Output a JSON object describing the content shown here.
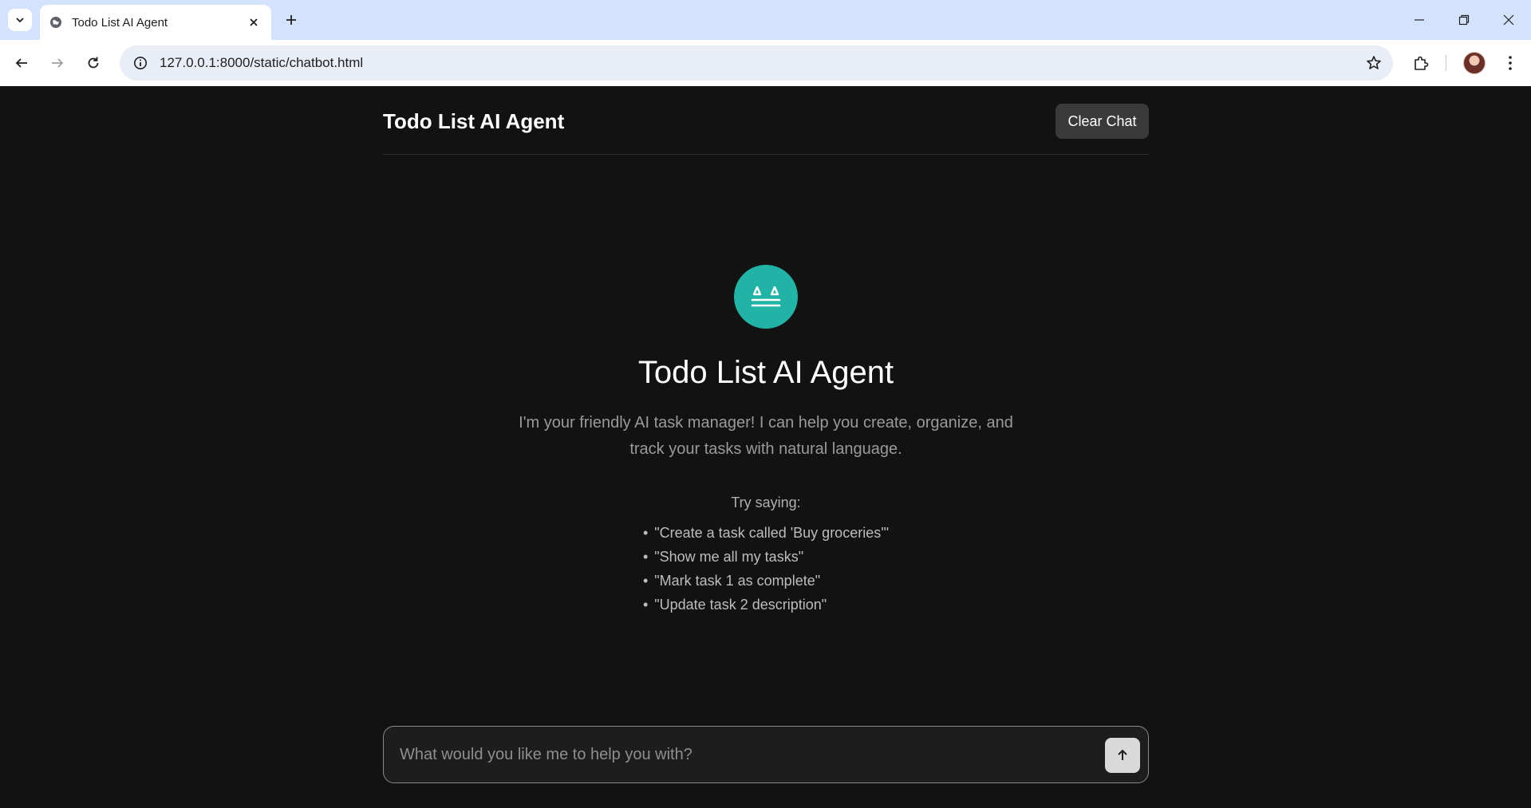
{
  "browser": {
    "tab_title": "Todo List AI Agent",
    "url": "127.0.0.1:8000/static/chatbot.html",
    "icons": {
      "tab_search": "chevron-down-icon",
      "favicon": "globe-icon",
      "tab_close": "close-icon",
      "new_tab": "plus-icon",
      "minimize": "minimize-icon",
      "restore": "restore-icon",
      "close": "close-icon",
      "back": "arrow-left-icon",
      "forward": "arrow-right-icon",
      "reload": "reload-icon",
      "site_info": "info-icon",
      "bookmark": "star-icon",
      "extensions": "puzzle-icon",
      "menu": "kebab-menu-icon"
    }
  },
  "app": {
    "header": {
      "title": "Todo List AI Agent",
      "clear_label": "Clear Chat"
    },
    "welcome": {
      "logo_icon": "agent-face-icon",
      "title": "Todo List AI Agent",
      "description": "I'm your friendly AI task manager! I can help you create, organize, and track your tasks with natural language.",
      "try_label": "Try saying:",
      "examples": [
        "\"Create a task called 'Buy groceries'\"",
        "\"Show me all my tasks\"",
        "\"Mark task 1 as complete\"",
        "\"Update task 2 description\""
      ]
    },
    "input": {
      "placeholder": "What would you like me to help you with?",
      "value": "",
      "send_icon": "arrow-up-icon"
    }
  },
  "colors": {
    "background": "#121212",
    "accent": "#21b3a6",
    "tabstrip": "#d3e3fd",
    "clear_button": "#3a3a3a"
  }
}
